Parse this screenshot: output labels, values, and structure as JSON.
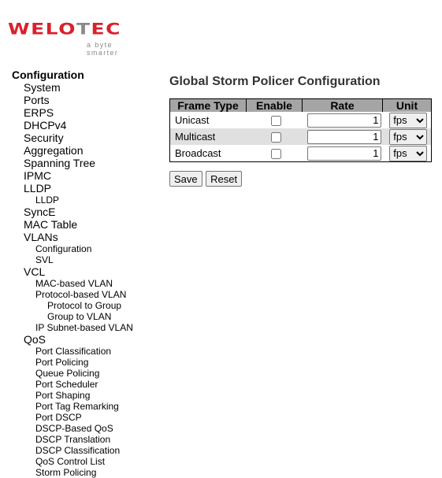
{
  "logo": {
    "word_red_1": "WELO",
    "word_gray": "T",
    "word_red_2": "EC",
    "tagline": "a byte smarter"
  },
  "nav": {
    "title": "Configuration",
    "items": [
      {
        "label": "System",
        "level": 1
      },
      {
        "label": "Ports",
        "level": 1
      },
      {
        "label": "ERPS",
        "level": 1
      },
      {
        "label": "DHCPv4",
        "level": 1
      },
      {
        "label": "Security",
        "level": 1
      },
      {
        "label": "Aggregation",
        "level": 1
      },
      {
        "label": "Spanning Tree",
        "level": 1
      },
      {
        "label": "IPMC",
        "level": 1
      },
      {
        "label": "LLDP",
        "level": 1
      },
      {
        "label": "LLDP",
        "level": 2
      },
      {
        "label": "SyncE",
        "level": 1
      },
      {
        "label": "MAC Table",
        "level": 1
      },
      {
        "label": "VLANs",
        "level": 1
      },
      {
        "label": "Configuration",
        "level": 2
      },
      {
        "label": "SVL",
        "level": 2
      },
      {
        "label": "VCL",
        "level": 1
      },
      {
        "label": "MAC-based VLAN",
        "level": 2
      },
      {
        "label": "Protocol-based VLAN",
        "level": 2
      },
      {
        "label": "Protocol to Group",
        "level": 3
      },
      {
        "label": "Group to VLAN",
        "level": 3
      },
      {
        "label": "IP Subnet-based VLAN",
        "level": 2
      },
      {
        "label": "QoS",
        "level": 1
      },
      {
        "label": "Port Classification",
        "level": 2
      },
      {
        "label": "Port Policing",
        "level": 2
      },
      {
        "label": "Queue Policing",
        "level": 2
      },
      {
        "label": "Port Scheduler",
        "level": 2
      },
      {
        "label": "Port Shaping",
        "level": 2
      },
      {
        "label": "Port Tag Remarking",
        "level": 2
      },
      {
        "label": "Port DSCP",
        "level": 2
      },
      {
        "label": "DSCP-Based QoS",
        "level": 2
      },
      {
        "label": "DSCP Translation",
        "level": 2
      },
      {
        "label": "DSCP Classification",
        "level": 2
      },
      {
        "label": "QoS Control List",
        "level": 2
      },
      {
        "label": "Storm Policing",
        "level": 2
      }
    ]
  },
  "main": {
    "title": "Global Storm Policer Configuration",
    "table": {
      "headers": [
        "Frame Type",
        "Enable",
        "Rate",
        "Unit"
      ],
      "rows": [
        {
          "frame_type": "Unicast",
          "enabled": false,
          "rate": "1",
          "unit": "fps"
        },
        {
          "frame_type": "Multicast",
          "enabled": false,
          "rate": "1",
          "unit": "fps"
        },
        {
          "frame_type": "Broadcast",
          "enabled": false,
          "rate": "1",
          "unit": "fps"
        }
      ]
    },
    "save_label": "Save",
    "reset_label": "Reset"
  },
  "colors": {
    "brand_red": "#d9212b",
    "header_bg": "#a5a5a5",
    "alt_row_bg": "#e0e0e0"
  }
}
